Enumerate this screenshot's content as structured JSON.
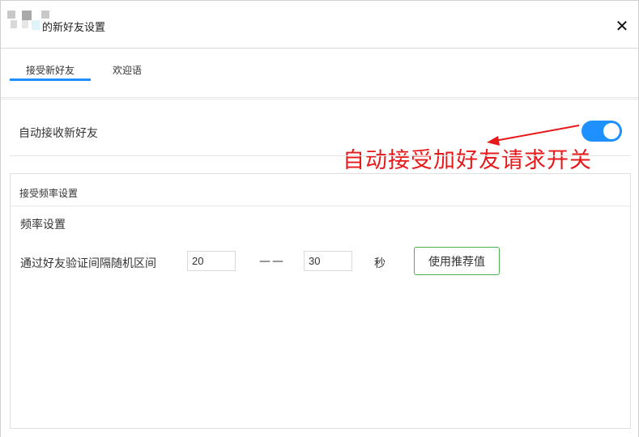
{
  "window": {
    "title": "的新好友设置",
    "close_glyph": "✕",
    "avatar_colors": [
      "#c8c8c8",
      "#a9a9a9",
      "#d9d9d9",
      "#e6e6e6",
      "#bdbdbd",
      "#dff3fb"
    ]
  },
  "tabs": [
    {
      "label": "接受新好友",
      "active": true
    },
    {
      "label": "欢迎语",
      "active": false
    }
  ],
  "auto_accept": {
    "label": "自动接收新好友",
    "enabled": true,
    "accent_color": "#1e90ff"
  },
  "annotation": {
    "text": "自动接受加好友请求开关",
    "color": "#e8191b"
  },
  "frequency": {
    "section_title": "接受频率设置",
    "sub_title": "频率设置",
    "interval_label": "通过好友验证间隔随机区间",
    "min_value": "20",
    "dash": "——",
    "max_value": "30",
    "unit": "秒",
    "recommend_button": "使用推荐值"
  }
}
